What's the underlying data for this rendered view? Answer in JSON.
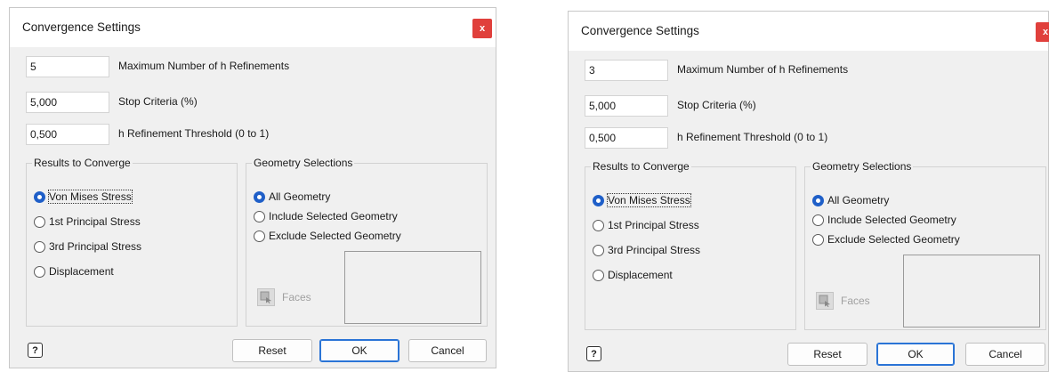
{
  "dialogs": [
    {
      "title": "Convergence Settings",
      "close_label": "x",
      "fields": [
        {
          "value": "5",
          "label": "Maximum Number of h Refinements"
        },
        {
          "value": "5,000",
          "label": "Stop Criteria (%)"
        },
        {
          "value": "0,500",
          "label": "h Refinement Threshold (0 to 1)"
        }
      ],
      "results_group": {
        "title": "Results to Converge",
        "options": [
          "Von Mises Stress",
          "1st Principal Stress",
          "3rd Principal Stress",
          "Displacement"
        ],
        "selected": "Von Mises Stress"
      },
      "geometry_group": {
        "title": "Geometry Selections",
        "options": [
          "All Geometry",
          "Include Selected Geometry",
          "Exclude Selected Geometry"
        ],
        "selected": "All Geometry",
        "faces_label": "Faces"
      },
      "help_label": "?",
      "buttons": {
        "reset": "Reset",
        "ok": "OK",
        "cancel": "Cancel"
      }
    },
    {
      "title": "Convergence Settings",
      "close_label": "x",
      "fields": [
        {
          "value": "3",
          "label": "Maximum Number of h Refinements"
        },
        {
          "value": "5,000",
          "label": "Stop Criteria (%)"
        },
        {
          "value": "0,500",
          "label": "h Refinement Threshold (0 to 1)"
        }
      ],
      "results_group": {
        "title": "Results to Converge",
        "options": [
          "Von Mises Stress",
          "1st Principal Stress",
          "3rd Principal Stress",
          "Displacement"
        ],
        "selected": "Von Mises Stress"
      },
      "geometry_group": {
        "title": "Geometry Selections",
        "options": [
          "All Geometry",
          "Include Selected Geometry",
          "Exclude Selected Geometry"
        ],
        "selected": "All Geometry",
        "faces_label": "Faces"
      },
      "help_label": "?",
      "buttons": {
        "reset": "Reset",
        "ok": "OK",
        "cancel": "Cancel"
      }
    }
  ],
  "colors": {
    "close_button": "#e0403c",
    "radio_selected": "#1f5fc8",
    "ok_border": "#2a74d6",
    "dialog_background": "#f0f0f0"
  },
  "icons": {
    "close": "close-icon",
    "help": "help-icon",
    "faces": "faces-select-icon"
  }
}
